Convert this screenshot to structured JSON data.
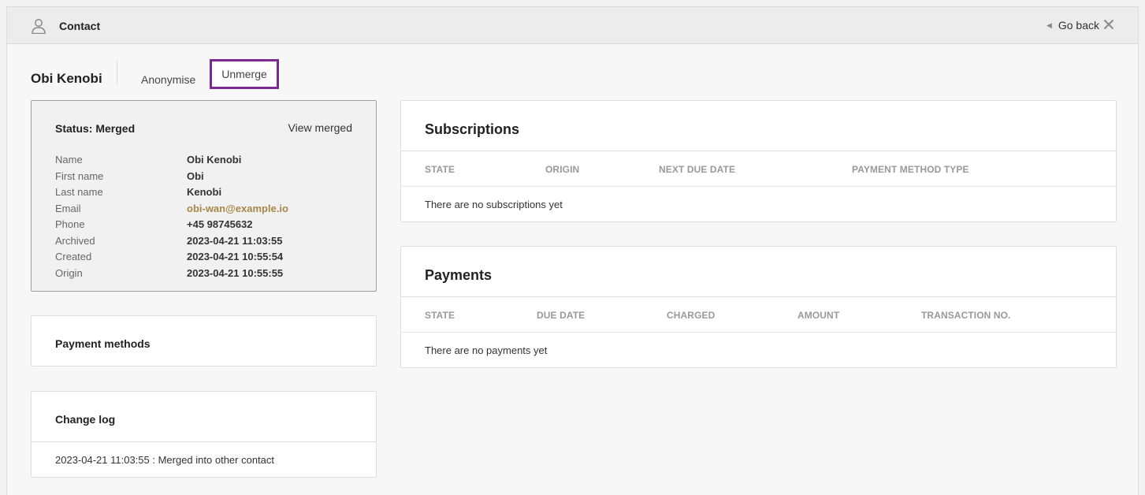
{
  "header": {
    "title": "Contact",
    "go_back": "Go back"
  },
  "contact": {
    "name": "Obi Kenobi",
    "actions": {
      "anonymise": "Anonymise",
      "unmerge": "Unmerge"
    }
  },
  "status": {
    "title": "Status: Merged",
    "view_merged": "View merged",
    "fields": [
      {
        "label": "Name",
        "value": "Obi Kenobi"
      },
      {
        "label": "First name",
        "value": "Obi"
      },
      {
        "label": "Last name",
        "value": "Kenobi"
      },
      {
        "label": "Email",
        "value": "obi-wan@example.io"
      },
      {
        "label": "Phone",
        "value": "+45 98745632"
      },
      {
        "label": "Archived",
        "value": "2023-04-21 11:03:55"
      },
      {
        "label": "Created",
        "value": "2023-04-21 10:55:54"
      },
      {
        "label": "Origin",
        "value": "2023-04-21 10:55:55"
      }
    ]
  },
  "payment_methods": {
    "title": "Payment methods"
  },
  "change_log": {
    "title": "Change log",
    "entries": [
      "2023-04-21 11:03:55 : Merged into other contact"
    ]
  },
  "subscriptions": {
    "title": "Subscriptions",
    "columns": [
      "STATE",
      "ORIGIN",
      "NEXT DUE DATE",
      "PAYMENT METHOD TYPE"
    ],
    "empty": "There are no subscriptions yet"
  },
  "payments": {
    "title": "Payments",
    "columns": [
      "STATE",
      "DUE DATE",
      "CHARGED",
      "AMOUNT",
      "TRANSACTION NO."
    ],
    "empty": "There are no payments yet"
  },
  "colors": {
    "accent_outline": "#7b2a93",
    "email_link": "#a8874a"
  },
  "icons": {
    "header": "person-icon",
    "back": "back-arrow-icon",
    "close": "close-icon"
  }
}
